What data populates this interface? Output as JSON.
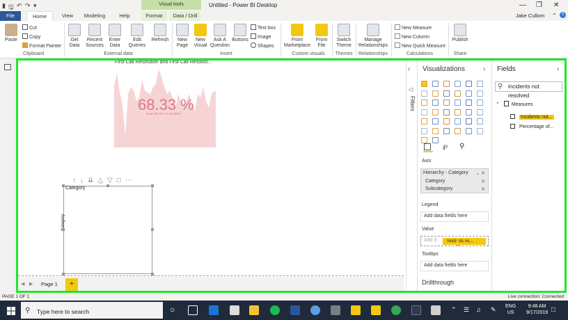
{
  "window": {
    "doc_title": "Untitled - Power BI Desktop",
    "context_tab_title": "Visual tools",
    "user": "Jake Cullom"
  },
  "tabs": [
    "File",
    "Home",
    "View",
    "Modeling",
    "Help",
    "Format",
    "Data / Drill"
  ],
  "ribbon": {
    "clipboard": {
      "paste": "Paste",
      "cut": "Cut",
      "copy": "Copy",
      "format_painter": "Format Painter",
      "group": "Clipboard"
    },
    "external_data": {
      "get_data": "Get Data",
      "recent_sources": "Recent Sources",
      "enter_data": "Enter Data",
      "edit_queries": "Edit Queries",
      "refresh": "Refresh",
      "group": "External data"
    },
    "insert": {
      "new_page": "New Page",
      "new_visual": "New Visual",
      "ask_question": "Ask A Question",
      "buttons": "Buttons",
      "text_box": "Text box",
      "image": "Image",
      "shapes": "Shapes",
      "group": "Insert"
    },
    "custom_visuals": {
      "from_marketplace": "From Marketplace",
      "from_file": "From File",
      "group": "Custom visuals"
    },
    "themes": {
      "switch_theme": "Switch Theme",
      "group": "Themes"
    },
    "relationships": {
      "manage": "Manage Relationships",
      "group": "Relationships"
    },
    "calculations": {
      "new_measure": "New Measure",
      "new_column": "New Column",
      "new_quick_measure": "New Quick Measure",
      "group": "Calculations"
    },
    "share": {
      "publish": "Publish",
      "group": "Share"
    }
  },
  "canvas": {
    "chart_title": "First Call Resolution and First Call Resoluti...",
    "kpi_value": "68.33 %",
    "kpi_goal": "Goal: 90.00 % (-24.09%)",
    "slicer_title": "Category",
    "slicer_axis_label": "Category"
  },
  "page_tabs": {
    "page1": "Page 1",
    "add": "+"
  },
  "filters_label": "Filters",
  "visualizations": {
    "title": "Visualizations",
    "axis_label": "Axis",
    "axis_fields": [
      "Hierarchy - Category",
      "Category",
      "Subcategory"
    ],
    "legend_label": "Legend",
    "legend_placeholder": "Add data fields here",
    "value_label": "Value",
    "value_placeholder": "Add d",
    "dragging_field": "Incidents no...",
    "tooltips_label": "Tooltips",
    "tooltips_placeholder": "Add data fields here",
    "drillthrough": "Drillthrough"
  },
  "fields": {
    "title": "Fields",
    "search_value": "incidents not resolved",
    "table": "Measures",
    "items": [
      "Incidents not...",
      "Percentage of..."
    ]
  },
  "status": {
    "page": "PAGE 1 OF 1",
    "connection": "Live connection: Connected"
  },
  "taskbar": {
    "search_placeholder": "Type here to search",
    "lang_top": "ENG",
    "lang_bottom": "US",
    "time": "9:48 AM",
    "date": "9/17/2019"
  }
}
